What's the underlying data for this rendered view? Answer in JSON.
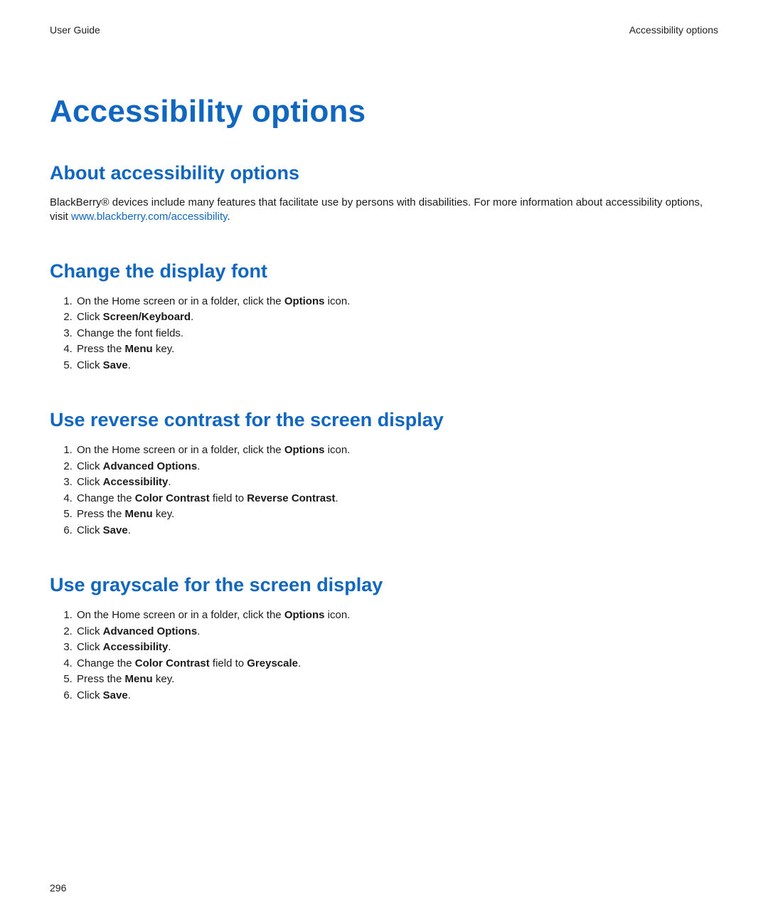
{
  "header": {
    "left": "User Guide",
    "right": "Accessibility options"
  },
  "title": "Accessibility options",
  "sections": {
    "about": {
      "heading": "About accessibility options",
      "introBefore": "BlackBerry® devices include many features that facilitate use by persons with disabilities. For more information about accessibility options, visit ",
      "link": "www.blackberry.com/accessibility",
      "introAfter": "."
    },
    "changeFont": {
      "heading": "Change the display font",
      "step1_a": "On the Home screen or in a folder, click the ",
      "step1_b": "Options",
      "step1_c": " icon.",
      "step2_a": "Click ",
      "step2_b": "Screen/Keyboard",
      "step2_c": ".",
      "step3": "Change the font fields.",
      "step4_a": "Press the ",
      "step4_b": "Menu",
      "step4_c": " key.",
      "step5_a": "Click ",
      "step5_b": "Save",
      "step5_c": "."
    },
    "reverse": {
      "heading": "Use reverse contrast for the screen display",
      "step1_a": "On the Home screen or in a folder, click the ",
      "step1_b": "Options",
      "step1_c": " icon.",
      "step2_a": "Click ",
      "step2_b": "Advanced Options",
      "step2_c": ".",
      "step3_a": "Click ",
      "step3_b": "Accessibility",
      "step3_c": ".",
      "step4_a": "Change the ",
      "step4_b": "Color Contrast",
      "step4_c": " field to ",
      "step4_d": "Reverse Contrast",
      "step4_e": ".",
      "step5_a": "Press the ",
      "step5_b": "Menu",
      "step5_c": " key.",
      "step6_a": "Click ",
      "step6_b": "Save",
      "step6_c": "."
    },
    "grayscale": {
      "heading": "Use grayscale for the screen display",
      "step1_a": "On the Home screen or in a folder, click the ",
      "step1_b": "Options",
      "step1_c": " icon.",
      "step2_a": "Click ",
      "step2_b": "Advanced Options",
      "step2_c": ".",
      "step3_a": "Click ",
      "step3_b": "Accessibility",
      "step3_c": ".",
      "step4_a": "Change the ",
      "step4_b": "Color Contrast",
      "step4_c": " field to ",
      "step4_d": "Greyscale",
      "step4_e": ".",
      "step5_a": "Press the ",
      "step5_b": "Menu",
      "step5_c": " key.",
      "step6_a": "Click ",
      "step6_b": "Save",
      "step6_c": "."
    }
  },
  "footer": {
    "page": "296"
  }
}
